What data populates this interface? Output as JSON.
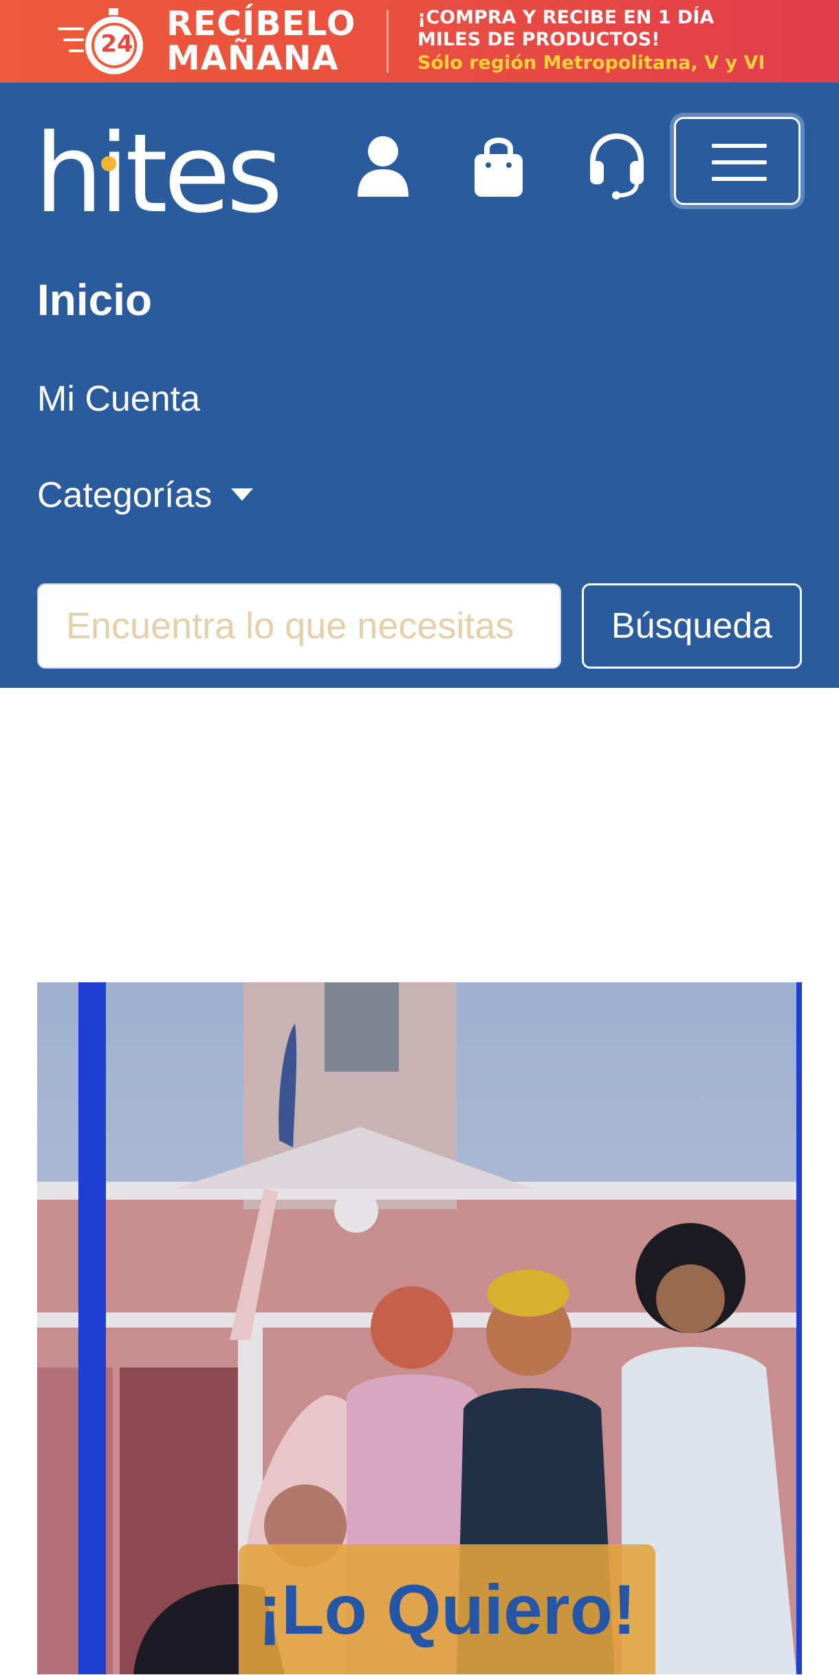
{
  "promo": {
    "timer_number": "24",
    "headline_1": "RECÍBELO",
    "headline_2": "MAÑANA",
    "line_1": "¡COMPRA Y RECIBE EN 1 DÍA",
    "line_2": "MILES DE PRODUCTOS!",
    "line_3": "Sólo región Metropolitana, V y VI",
    "colors": {
      "background": "#ea4f3f",
      "accent": "#ffd23d",
      "text": "#ffffff"
    }
  },
  "header": {
    "logo_text": "hites",
    "logo_dot_color": "#f5b335",
    "background_color": "#2a5b9d",
    "icons": [
      "user-icon",
      "shopping-bag-icon",
      "headset-support-icon",
      "menu-icon"
    ]
  },
  "nav": {
    "inicio": "Inicio",
    "mi_cuenta": "Mi Cuenta",
    "categorias": "Categorías"
  },
  "search": {
    "placeholder": "Encuentra lo que necesitas",
    "value": "",
    "button_label": "Búsqueda"
  },
  "hero": {
    "image": "photo-group-of-women-in-front-of-building",
    "cta_label": "¡Lo Quiero!",
    "cta_color": "#2556a6"
  }
}
